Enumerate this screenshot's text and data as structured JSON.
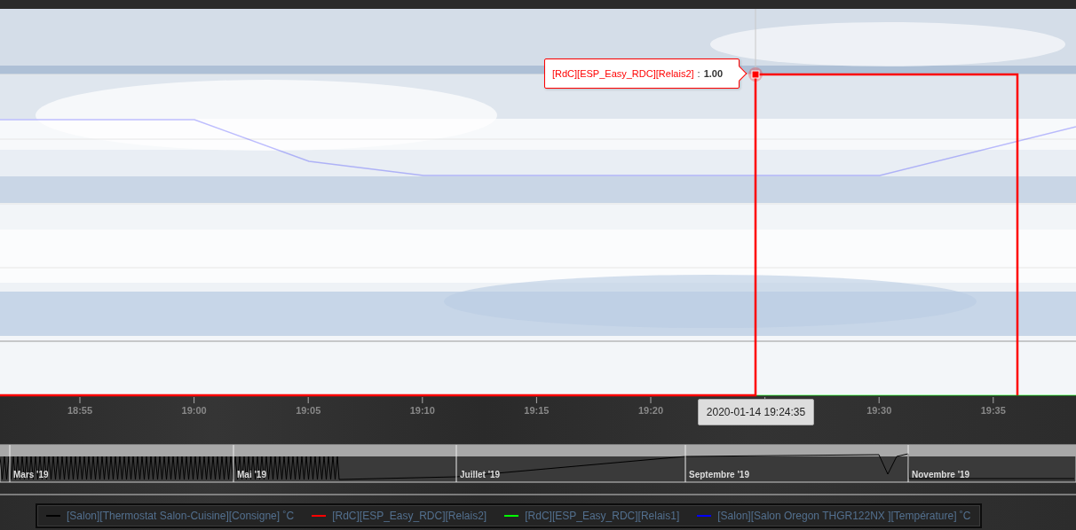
{
  "chart": {
    "tooltip": {
      "series": "[RdC][ESP_Easy_RDC][Relais2]",
      "separator": ":",
      "value": "1.00",
      "color": "#ff0000"
    },
    "crosshair_label": "2020-01-14 19:24:35",
    "x_ticks": [
      "18:55",
      "19:00",
      "19:05",
      "19:10",
      "19:15",
      "19:20",
      "19:30",
      "19:35"
    ]
  },
  "navigator": {
    "labels": [
      "Mars '19",
      "Mai '19",
      "Juillet '19",
      "Septembre '19",
      "Novembre '19"
    ]
  },
  "legend": [
    {
      "label": "[Salon][Thermostat Salon-Cuisine][Consigne] ˚C",
      "color": "#000000"
    },
    {
      "label": "[RdC][ESP_Easy_RDC][Relais2]",
      "color": "#ff0000"
    },
    {
      "label": "[RdC][ESP_Easy_RDC][Relais1]",
      "color": "#00ff00"
    },
    {
      "label": "[Salon][Salon Oregon THGR122NX ][Température] ˚C",
      "color": "#0000ff"
    }
  ]
}
